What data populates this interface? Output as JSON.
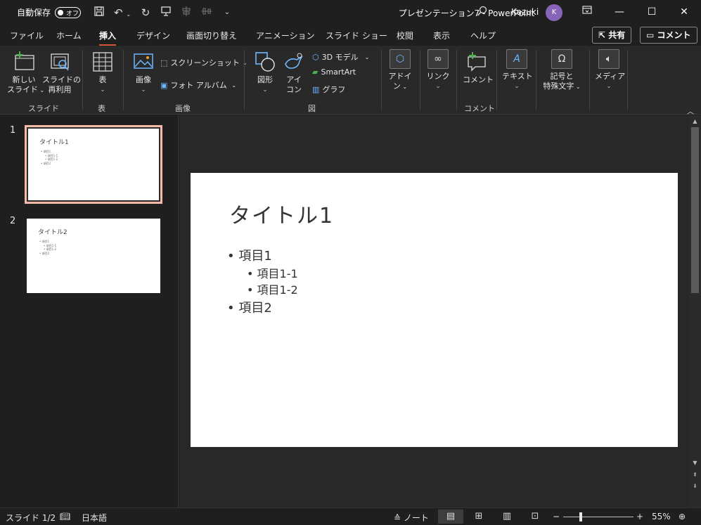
{
  "titlebar": {
    "autosave_label": "自動保存",
    "autosave_state": "オフ",
    "doc_title": "プレゼンテーション7  -  PowerPoint",
    "user_name": "Kazuki",
    "user_initial": "K"
  },
  "tabs": [
    "ファイル",
    "ホーム",
    "挿入",
    "デザイン",
    "画面切り替え",
    "アニメーション",
    "スライド ショー",
    "校閲",
    "表示",
    "ヘルプ"
  ],
  "share_label": "共有",
  "comment_label": "コメント",
  "ribbon": {
    "new_slide_1": "新しい",
    "new_slide_2": "スライド",
    "reuse_1": "スライドの",
    "reuse_2": "再利用",
    "group_slides": "スライド",
    "table": "表",
    "group_table": "表",
    "images": "画像",
    "screenshot": "スクリーンショット",
    "photo_album": "フォト アルバム",
    "group_images": "画像",
    "shapes": "図形",
    "icons_1": "アイ",
    "icons_2": "コン",
    "model3d": "3D モデル",
    "smartart": "SmartArt",
    "chart": "グラフ",
    "group_illustrations": "図",
    "addins_1": "アドイ",
    "addins_2": "ン",
    "link": "リンク",
    "comment": "コメント",
    "group_comments": "コメント",
    "text": "テキスト",
    "symbols_1": "記号と",
    "symbols_2": "特殊文字",
    "media": "メディア"
  },
  "thumbnails": [
    {
      "num": "1",
      "title": "タイトル1",
      "b1": "項目1",
      "b11": "項目1-1",
      "b12": "項目1-2",
      "b2": "項目2"
    },
    {
      "num": "2",
      "title": "タイトル2",
      "b1": "項目1",
      "b11": "項目1-1",
      "b12": "項目1-2",
      "b2": "項目2"
    }
  ],
  "slide": {
    "title": "タイトル1",
    "bullet1": "• 項目1",
    "bullet11": "• 項目1-1",
    "bullet12": "• 項目1-2",
    "bullet2": "• 項目2"
  },
  "status": {
    "slide_count": "スライド 1/2",
    "language": "日本語",
    "notes": "ノート",
    "zoom": "55%",
    "zoom_fraction": 0.25
  },
  "colors": {
    "accent": "#d35230",
    "avatar": "#8764b8",
    "selected_thumb": "#f4b9a7"
  }
}
